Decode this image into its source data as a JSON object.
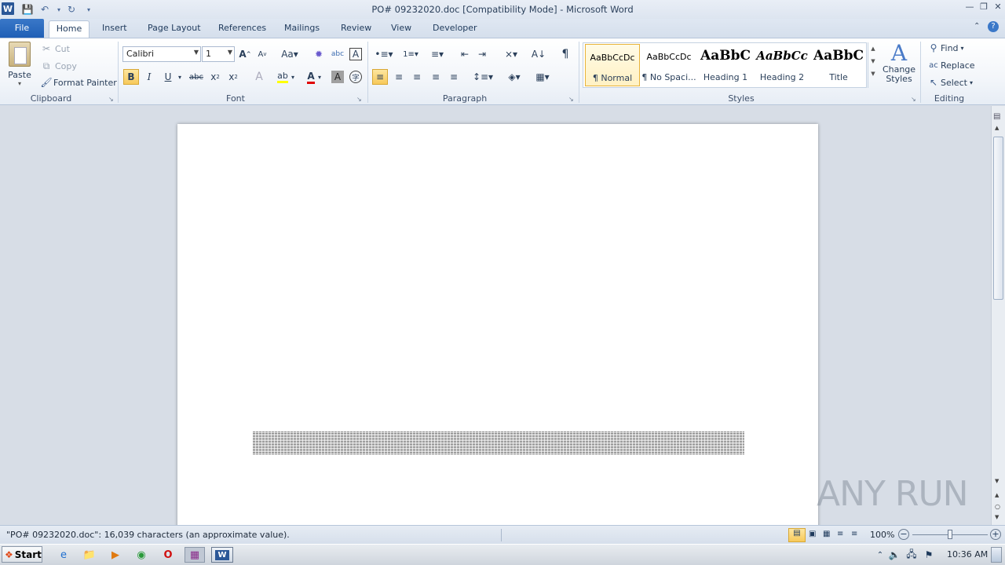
{
  "window": {
    "title": "PO# 09232020.doc [Compatibility Mode]  -  Microsoft Word"
  },
  "tabs": [
    {
      "label": "File"
    },
    {
      "label": "Home"
    },
    {
      "label": "Insert"
    },
    {
      "label": "Page Layout"
    },
    {
      "label": "References"
    },
    {
      "label": "Mailings"
    },
    {
      "label": "Review"
    },
    {
      "label": "View"
    },
    {
      "label": "Developer"
    }
  ],
  "ribbon": {
    "clipboard": {
      "paste_label": "Paste",
      "cut_label": "Cut",
      "copy_label": "Copy",
      "format_painter_label": "Format Painter",
      "group_label": "Clipboard"
    },
    "font": {
      "font_name": "Calibri",
      "font_size": "1",
      "group_label": "Font"
    },
    "paragraph": {
      "group_label": "Paragraph"
    },
    "styles": {
      "items": [
        {
          "preview": "AaBbCcDc",
          "label": "¶ Normal"
        },
        {
          "preview": "AaBbCcDc",
          "label": "¶ No Spaci..."
        },
        {
          "preview": "AaBbC",
          "label": "Heading 1"
        },
        {
          "preview": "AaBbCc",
          "label": "Heading 2"
        },
        {
          "preview": "AaBbC",
          "label": "Title"
        }
      ],
      "change_styles_label": "Change Styles",
      "group_label": "Styles"
    },
    "editing": {
      "find_label": "Find",
      "replace_label": "Replace",
      "select_label": "Select",
      "group_label": "Editing"
    }
  },
  "statusbar": {
    "message": "\"PO# 09232020.doc\": 16,039 characters (an approximate value).",
    "zoom": "100%"
  },
  "taskbar": {
    "start_label": "Start",
    "clock": "10:36 AM"
  },
  "watermark": "ANY RUN",
  "colors": {
    "file_tab": "#2a6bc0",
    "ribbon_bg": "#f3f6fa",
    "doc_bg": "#d7dde6"
  }
}
